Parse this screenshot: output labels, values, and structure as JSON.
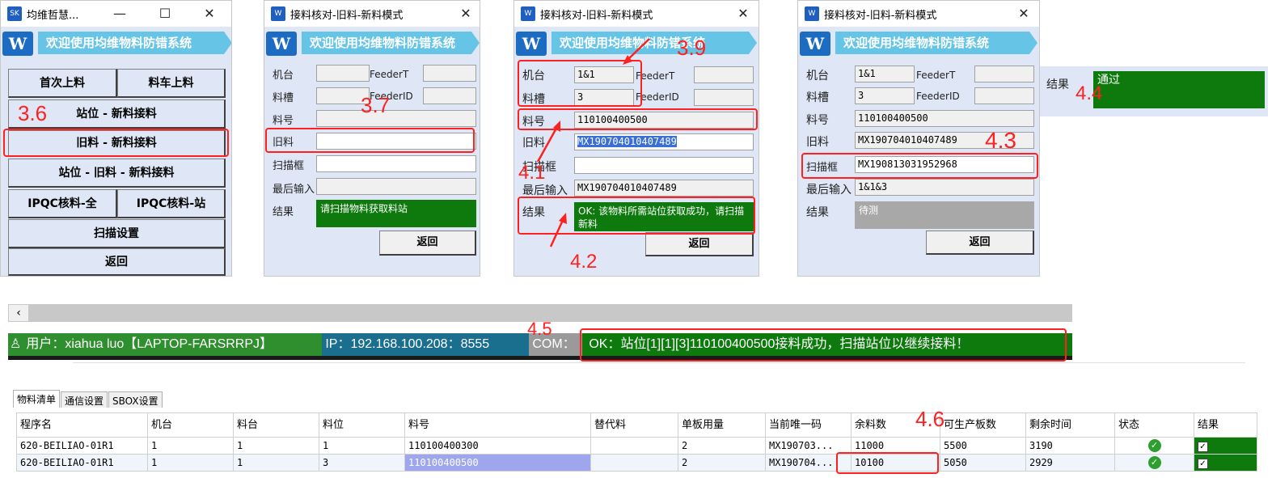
{
  "win1": {
    "title": "均维哲慧...",
    "banner": "欢迎使用均维物料防错系统",
    "buttons": [
      "首次上料",
      "料车上料",
      "站位 - 新料接料",
      "旧料 - 新料接料",
      "站位 - 旧料 - 新料接料",
      "IPQC核料-全",
      "IPQC核料-站",
      "扫描设置",
      "返回"
    ]
  },
  "common": {
    "dialog_title": "接料核对-旧料-新料模式",
    "banner": "欢迎使用均维物料防错系统",
    "logo_text": "W",
    "lbl_machine": "机台",
    "lbl_slot": "料槽",
    "lbl_part": "料号",
    "lbl_old": "旧料",
    "lbl_scan": "扫描框",
    "lbl_last": "最后输入",
    "lbl_result": "结果",
    "lbl_feedert": "FeederT",
    "lbl_feederid": "FeederID",
    "back": "返回"
  },
  "win2": {
    "result": "请扫描物料获取料站"
  },
  "win3": {
    "machine": "1&1",
    "slot": "3",
    "part": "110100400500",
    "old": "MX190704010407489",
    "last": "MX190704010407489",
    "result": "OK: 该物料所需站位获取成功，请扫描新料"
  },
  "win4": {
    "machine": "1&1",
    "slot": "3",
    "part": "110100400500",
    "old": "MX190704010407489",
    "scan": "MX190813031952968",
    "last": "1&1&3",
    "result": "待测"
  },
  "result_panel": {
    "label": "结果",
    "value": "通过"
  },
  "annotations": [
    "3.6",
    "3.7",
    "3.9",
    "4.1",
    "4.2",
    "4.3",
    "4.4",
    "4.5",
    "4.6"
  ],
  "statusbar": {
    "user": "用户：xiahua luo【LAPTOP-FARSRRPJ】",
    "ip": "IP：192.168.100.208：8555",
    "com": "COM：",
    "message": "OK：站位[1][1][3]110100400500接料成功，扫描站位以继续接料！"
  },
  "tabs": [
    "物料清单",
    "通信设置",
    "SBOX设置"
  ],
  "table": {
    "headers": [
      "程序名",
      "机台",
      "料台",
      "料位",
      "料号",
      "替代料",
      "单板用量",
      "当前唯一码",
      "余料数",
      "可生产板数",
      "剩余时间",
      "状态",
      "结果"
    ],
    "rows": [
      [
        "620-BEILIAO-01R1",
        "1",
        "1",
        "1",
        "110100400300",
        "",
        "2",
        "MX190703...",
        "11000",
        "5500",
        "3190"
      ],
      [
        "620-BEILIAO-01R1",
        "1",
        "1",
        "3",
        "110100400500",
        "",
        "2",
        "MX190704...",
        "10100",
        "5050",
        "2929"
      ]
    ]
  },
  "colors": {
    "accent": "#1d6cc4",
    "banner": "#66c5e6",
    "ok_green": "#0e7a0e",
    "annotation_red": "#ff2020"
  }
}
